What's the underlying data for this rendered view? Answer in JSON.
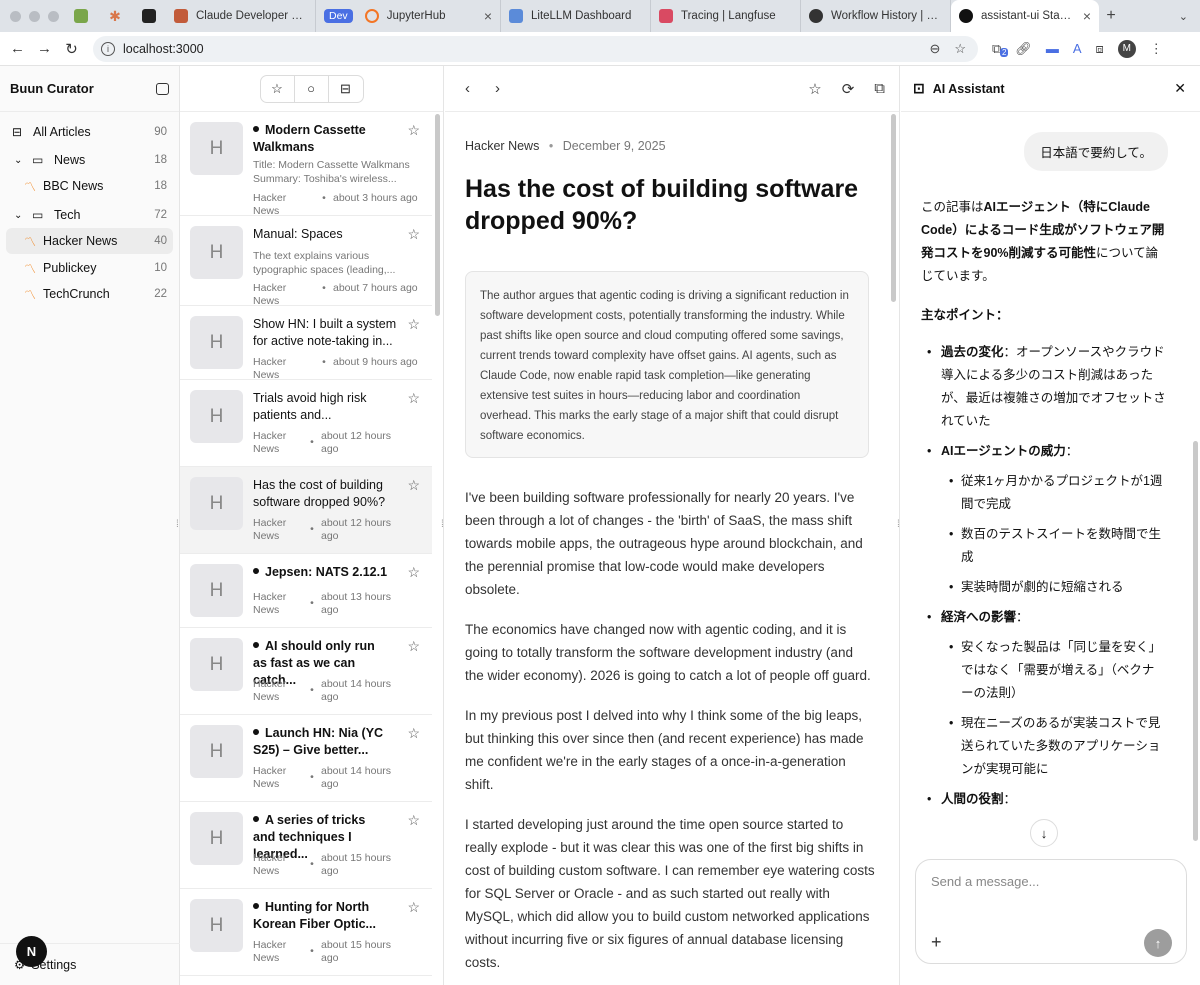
{
  "browser": {
    "tabs": [
      {
        "title": "Claude Developer Platf",
        "color": "#c25b3a"
      },
      {
        "title": "JupyterHub",
        "color": "#f37626",
        "badge": "Dev"
      },
      {
        "title": "LiteLLM Dashboard",
        "color": "#5b8bd9"
      },
      {
        "title": "Tracing | Langfuse",
        "color": "#d94a62"
      },
      {
        "title": "Workflow History | pro",
        "color": "#333333"
      },
      {
        "title": "assistant-ui Starter Ap",
        "color": "#111111"
      }
    ],
    "url": "localhost:3000",
    "profile_initial": "M",
    "ext_badge": "2"
  },
  "sidebar": {
    "title": "Buun Curator",
    "items": [
      {
        "label": "All Articles",
        "count": "90"
      },
      {
        "label": "News",
        "count": "18"
      },
      {
        "label": "BBC News",
        "count": "18"
      },
      {
        "label": "Tech",
        "count": "72"
      },
      {
        "label": "Hacker News",
        "count": "40"
      },
      {
        "label": "Publickey",
        "count": "10"
      },
      {
        "label": "TechCrunch",
        "count": "22"
      }
    ],
    "settings_label": "Settings",
    "logo_letter": "N"
  },
  "articles": [
    {
      "thumb": "H",
      "title": "Modern Cassette Walkmans",
      "summary": "Title: Modern Cassette Walkmans Summary: Toshiba's wireless...",
      "source": "Hacker News",
      "ago": "about 3 hours ago"
    },
    {
      "thumb": "H",
      "title": "Manual: Spaces",
      "summary": "The text explains various typographic spaces (leading,...",
      "source": "Hacker News",
      "ago": "about 7 hours ago"
    },
    {
      "thumb": "H",
      "title": "Show HN: I built a system for active note-taking in...",
      "source": "Hacker News",
      "ago": "about 9 hours ago"
    },
    {
      "thumb": "H",
      "title": "Trials avoid high risk patients and...",
      "source": "Hacker News",
      "ago": "about 12 hours ago"
    },
    {
      "thumb": "H",
      "title": "Has the cost of building software dropped 90%?",
      "source": "Hacker News",
      "ago": "about 12 hours ago"
    },
    {
      "thumb": "H",
      "title": "Jepsen: NATS 2.12.1",
      "source": "Hacker News",
      "ago": "about 13 hours ago"
    },
    {
      "thumb": "H",
      "title": "AI should only run as fast as we can catch...",
      "source": "Hacker News",
      "ago": "about 14 hours ago"
    },
    {
      "thumb": "H",
      "title": "Launch HN: Nia (YC S25) – Give better...",
      "source": "Hacker News",
      "ago": "about 14 hours ago"
    },
    {
      "thumb": "H",
      "title": "A series of tricks and techniques I learned...",
      "source": "Hacker News",
      "ago": "about 15 hours ago"
    },
    {
      "thumb": "H",
      "title": "Hunting for North Korean Fiber Optic...",
      "source": "Hacker News",
      "ago": "about 15 hours ago"
    }
  ],
  "reader": {
    "source": "Hacker News",
    "date": "December 9, 2025",
    "title": "Has the cost of building software dropped 90%?",
    "summary": "The author argues that agentic coding is driving a significant reduction in software development costs, potentially transforming the industry. While past shifts like open source and cloud computing offered some savings, current trends toward complexity have offset gains. AI agents, such as Claude Code, now enable rapid task completion—like generating extensive test suites in hours—reducing labor and coordination overhead. This marks the early stage of a major shift that could disrupt software economics.",
    "paragraphs": [
      "I've been building software professionally for nearly 20 years. I've been through a lot of changes - the 'birth' of SaaS, the mass shift towards mobile apps, the outrageous hype around blockchain, and the perennial promise that low-code would make developers obsolete.",
      "The economics have changed now with agentic coding, and it is going to totally transform the software development industry (and the wider economy). 2026 is going to catch a lot of people off guard.",
      "In my previous post I delved into why I think some of the big leaps, but thinking this over since then (and recent experience) has made me confident we're in the early stages of a once-in-a-generation shift.",
      "I started developing just around the time open source started to really explode - but it was clear this was one of the first big shifts in cost of building custom software. I can remember eye watering costs for SQL Server or Oracle - and as such started out really with MySQL, which did allow you to build custom networked applications without incurring five or six figures of annual database licensing costs."
    ]
  },
  "assistant": {
    "title": "AI Assistant",
    "user_message": "日本語で要約して。",
    "intro_pre": "この記事は",
    "intro_bold": "AIエージェント（特にClaude Code）によるコード生成がソフトウェア開発コストを90%削減する可能性",
    "intro_post": "について論じています。",
    "points_heading": "主なポイント：",
    "points": [
      {
        "label": "過去の変化",
        "text": "：オープンソースやクラウド導入による多少のコスト削減はあったが、最近は複雑さの増加でオフセットされていた",
        "sub": []
      },
      {
        "label": "AIエージェントの威力",
        "text": "：",
        "sub": [
          "従来1ヶ月かかるプロジェクトが1週間で完成",
          "数百のテストスイートを数時間で生成",
          "実装時間が劇的に短縮される"
        ]
      },
      {
        "label": "経済への影響",
        "text": "：",
        "sub": [
          "安くなった製品は「同じ量を安く」ではなく「需要が増える」（ベクナーの法則）",
          "現在ニーズのあるが実装コストで見送られていた多数のアプリケーションが実現可能に"
        ]
      },
      {
        "label": "人間の役割",
        "text": "：",
        "sub": []
      }
    ],
    "input_placeholder": "Send a message..."
  }
}
